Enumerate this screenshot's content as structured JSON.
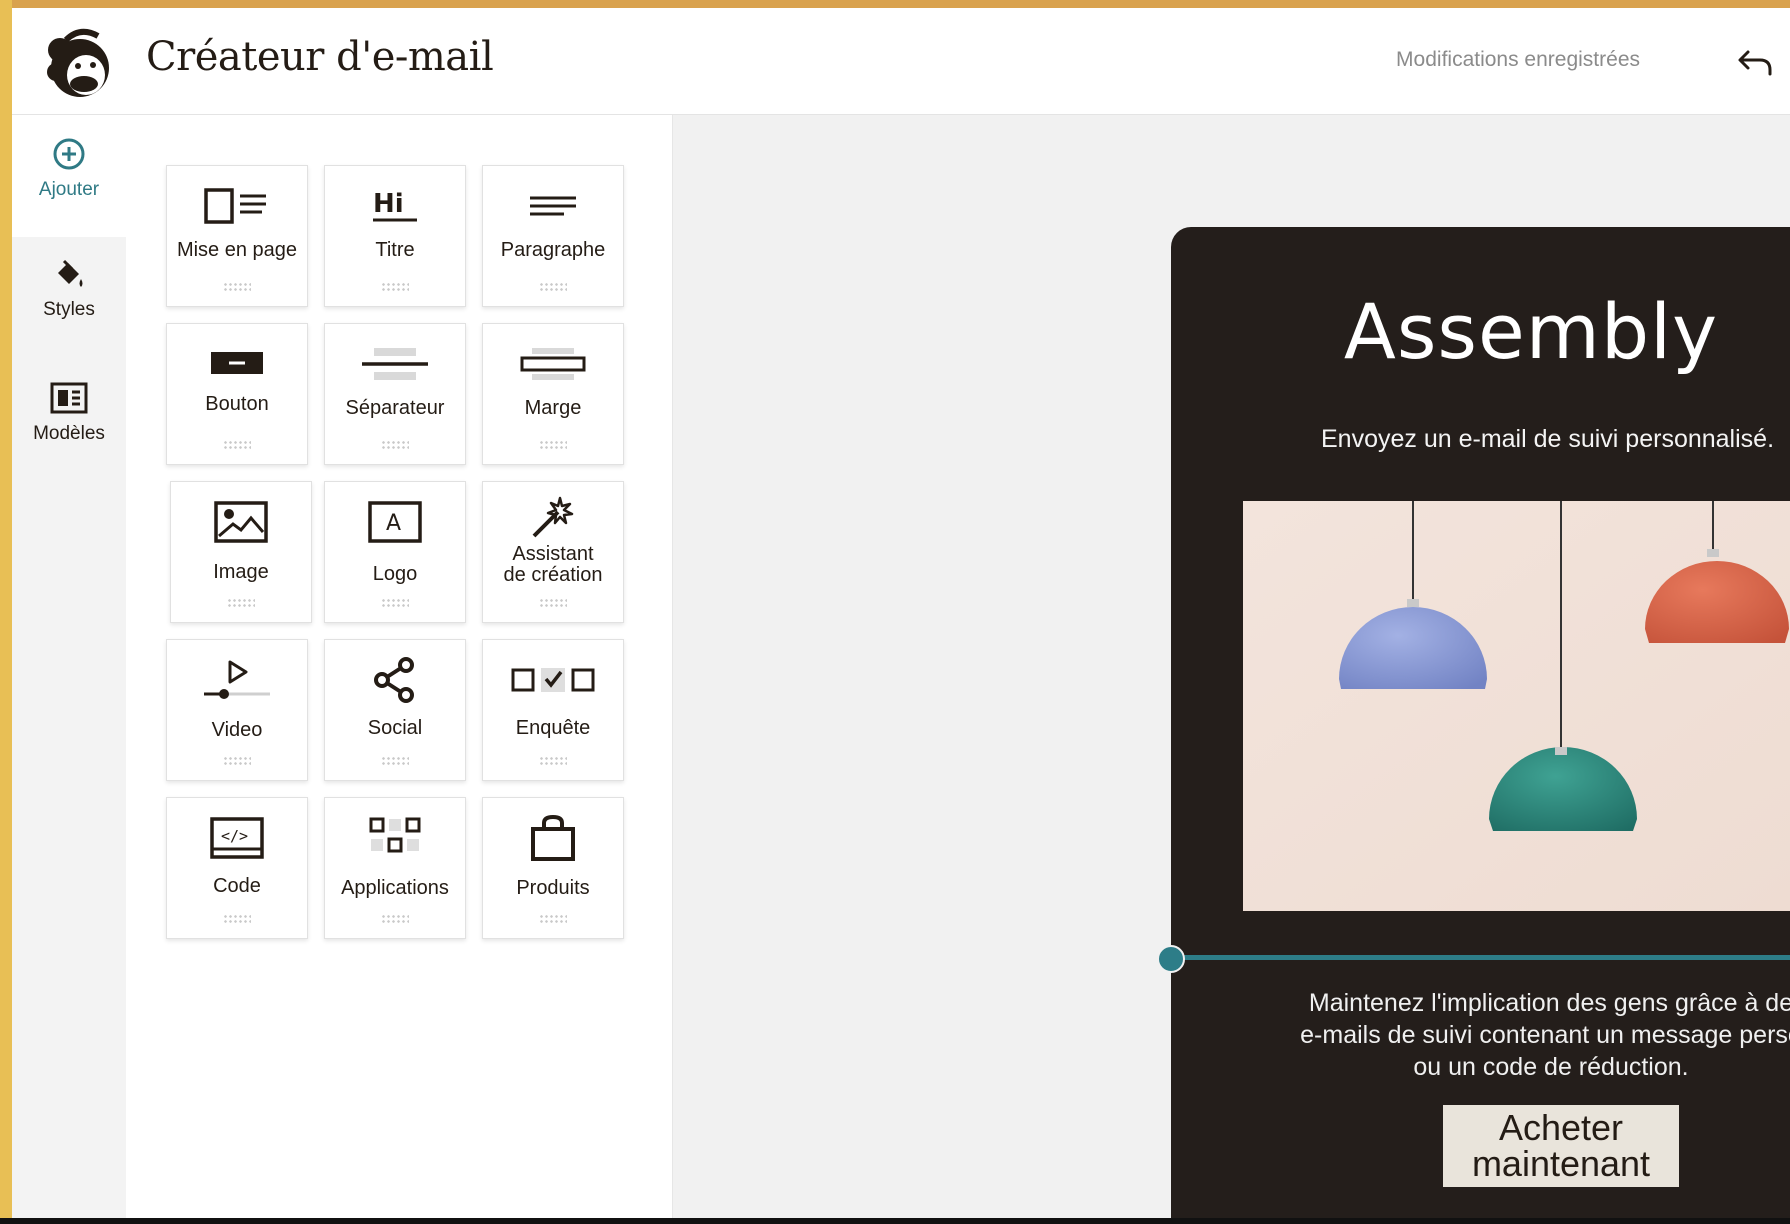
{
  "header": {
    "title": "Créateur d'e-mail",
    "save_status": "Modifications enregistrées"
  },
  "rail": {
    "items": [
      {
        "label": "Ajouter",
        "icon": "plus-circle-icon",
        "active": true
      },
      {
        "label": "Styles",
        "icon": "paint-bucket-icon",
        "active": false
      },
      {
        "label": "Modèles",
        "icon": "template-icon",
        "active": false
      }
    ]
  },
  "blocks": [
    {
      "label": "Mise en page",
      "icon": "layout-icon"
    },
    {
      "label": "Titre",
      "icon": "heading-icon"
    },
    {
      "label": "Paragraphe",
      "icon": "paragraph-icon"
    },
    {
      "label": "Bouton",
      "icon": "button-icon"
    },
    {
      "label": "Séparateur",
      "icon": "divider-icon"
    },
    {
      "label": "Marge",
      "icon": "spacer-icon"
    },
    {
      "label": "Image",
      "icon": "image-icon"
    },
    {
      "label": "Logo",
      "icon": "logo-icon"
    },
    {
      "label": "Assistant de création",
      "label_line1": "Assistant",
      "label_line2": "de création",
      "icon": "magic-wand-icon"
    },
    {
      "label": "Video",
      "icon": "video-icon"
    },
    {
      "label": "Social",
      "icon": "share-icon"
    },
    {
      "label": "Enquête",
      "icon": "survey-icon"
    },
    {
      "label": "Code",
      "icon": "code-icon"
    },
    {
      "label": "Applications",
      "icon": "apps-icon"
    },
    {
      "label": "Produits",
      "icon": "shopping-bag-icon"
    }
  ],
  "email": {
    "brand": "Assembly",
    "subtitle": "Envoyez un e-mail de suivi personnalisé.",
    "body_lines": [
      "Maintenez l'implication des gens grâce à de",
      "e-mails de suivi contenant un message perso",
      "ou un code de réduction."
    ],
    "cta_line1": "Acheter",
    "cta_line2": "maintenant"
  },
  "colors": {
    "accent": "#2d7d88",
    "email_background": "#241e1b",
    "cta_background": "#e9e4db",
    "lamp_blue": "#8797d2",
    "lamp_teal": "#2f8a80",
    "lamp_orange": "#d8664a"
  }
}
